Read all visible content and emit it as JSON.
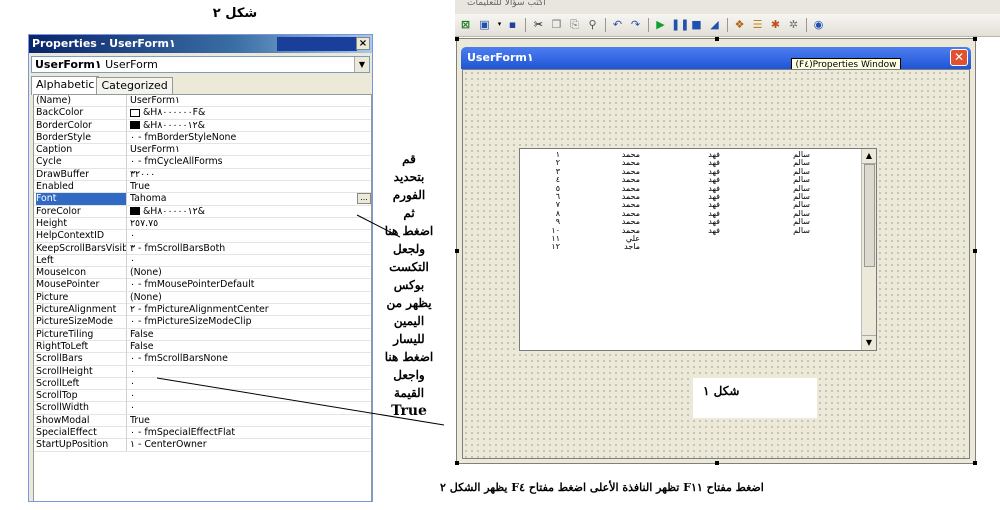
{
  "captions": {
    "left_figure": "شكل ٢",
    "bottom": "اضغط مفتاح     F١١     تظهر النافذة الأعلى   اضغط مفتاح   F٤  يظهر الشكل ٢"
  },
  "properties_window": {
    "title": "Properties - UserForm١",
    "close_glyph": "×",
    "object_name_bold": "UserForm١",
    "object_type": "UserForm",
    "dropdown_glyph": "▼",
    "tabs": [
      "Alphabetic",
      "Categorized"
    ],
    "rows": [
      {
        "name": "(Name)",
        "value": "UserForm١"
      },
      {
        "name": "BackColor",
        "value": "&H٨٠٠٠٠٠٠F&",
        "swatch": "white"
      },
      {
        "name": "BorderColor",
        "value": "&H٨٠٠٠٠٠١٢&",
        "swatch": "black"
      },
      {
        "name": "BorderStyle",
        "value": "٠ - fmBorderStyleNone"
      },
      {
        "name": "Caption",
        "value": "UserForm١"
      },
      {
        "name": "Cycle",
        "value": "٠ - fmCycleAllForms"
      },
      {
        "name": "DrawBuffer",
        "value": "٣٢٠٠٠"
      },
      {
        "name": "Enabled",
        "value": "True"
      },
      {
        "name": "Font",
        "value": "Tahoma",
        "selected": true
      },
      {
        "name": "ForeColor",
        "value": "&H٨٠٠٠٠٠١٢&",
        "swatch": "black"
      },
      {
        "name": "Height",
        "value": "٢٥٧.٧٥"
      },
      {
        "name": "HelpContextID",
        "value": "٠"
      },
      {
        "name": "KeepScrollBarsVisible",
        "value": "٣ - fmScrollBarsBoth"
      },
      {
        "name": "Left",
        "value": "٠"
      },
      {
        "name": "MouseIcon",
        "value": "(None)"
      },
      {
        "name": "MousePointer",
        "value": "٠ - fmMousePointerDefault"
      },
      {
        "name": "Picture",
        "value": "(None)"
      },
      {
        "name": "PictureAlignment",
        "value": "٢ - fmPictureAlignmentCenter"
      },
      {
        "name": "PictureSizeMode",
        "value": "٠ - fmPictureSizeModeClip"
      },
      {
        "name": "PictureTiling",
        "value": "False"
      },
      {
        "name": "RightToLeft",
        "value": "False"
      },
      {
        "name": "ScrollBars",
        "value": "٠ - fmScrollBarsNone"
      },
      {
        "name": "ScrollHeight",
        "value": "٠"
      },
      {
        "name": "ScrollLeft",
        "value": "٠"
      },
      {
        "name": "ScrollTop",
        "value": "٠"
      },
      {
        "name": "ScrollWidth",
        "value": "٠"
      },
      {
        "name": "ShowModal",
        "value": "True"
      },
      {
        "name": "SpecialEffect",
        "value": "٠ - fmSpecialEffectFlat"
      },
      {
        "name": "StartUpPosition",
        "value": "١ - CenterOwner"
      }
    ],
    "font_button_glyph": "..."
  },
  "notes": [
    "قم",
    "بتحديد",
    "الفورم",
    "ثم",
    "اضغط هنا",
    "ولجعل",
    "التكست",
    "بوكس",
    "يظهر من",
    "اليمين",
    "لليسار",
    "اضغط هنا",
    "واجعل",
    "القيمة",
    "True"
  ],
  "editor": {
    "top_strip_label": "اكتب سؤالا للتعليمات",
    "toolbar_icons": [
      "excel-icon",
      "insert-userform-icon",
      "save-icon",
      "cut-icon",
      "copy-icon",
      "paste-icon",
      "find-icon",
      "undo-icon",
      "redo-icon",
      "run-icon",
      "break-icon",
      "reset-icon",
      "design-mode-icon",
      "project-explorer-icon",
      "properties-icon",
      "object-browser-icon",
      "toolbox-icon",
      "help-icon"
    ],
    "userform_title": "UserForm١",
    "tooltip": "(F٤)Properties Window",
    "close_glyph": "✕",
    "listbox": {
      "rows": [
        [
          "١",
          "محمد",
          "فهد",
          "سالم"
        ],
        [
          "٢",
          "محمد",
          "فهد",
          "سالم"
        ],
        [
          "٣",
          "محمد",
          "فهد",
          "سالم"
        ],
        [
          "٤",
          "محمد",
          "فهد",
          "سالم"
        ],
        [
          "٥",
          "محمد",
          "فهد",
          "سالم"
        ],
        [
          "٦",
          "محمد",
          "فهد",
          "سالم"
        ],
        [
          "٧",
          "محمد",
          "فهد",
          "سالم"
        ],
        [
          "٨",
          "محمد",
          "فهد",
          "سالم"
        ],
        [
          "٩",
          "محمد",
          "فهد",
          "سالم"
        ],
        [
          "١٠",
          "محمد",
          "فهد",
          "سالم"
        ],
        [
          "١١",
          "علي",
          "",
          ""
        ],
        [
          "١٢",
          "ماجد",
          "",
          ""
        ]
      ],
      "scroll_up_glyph": "▲",
      "scroll_down_glyph": "▼"
    },
    "label_caption": "شكل ١"
  }
}
